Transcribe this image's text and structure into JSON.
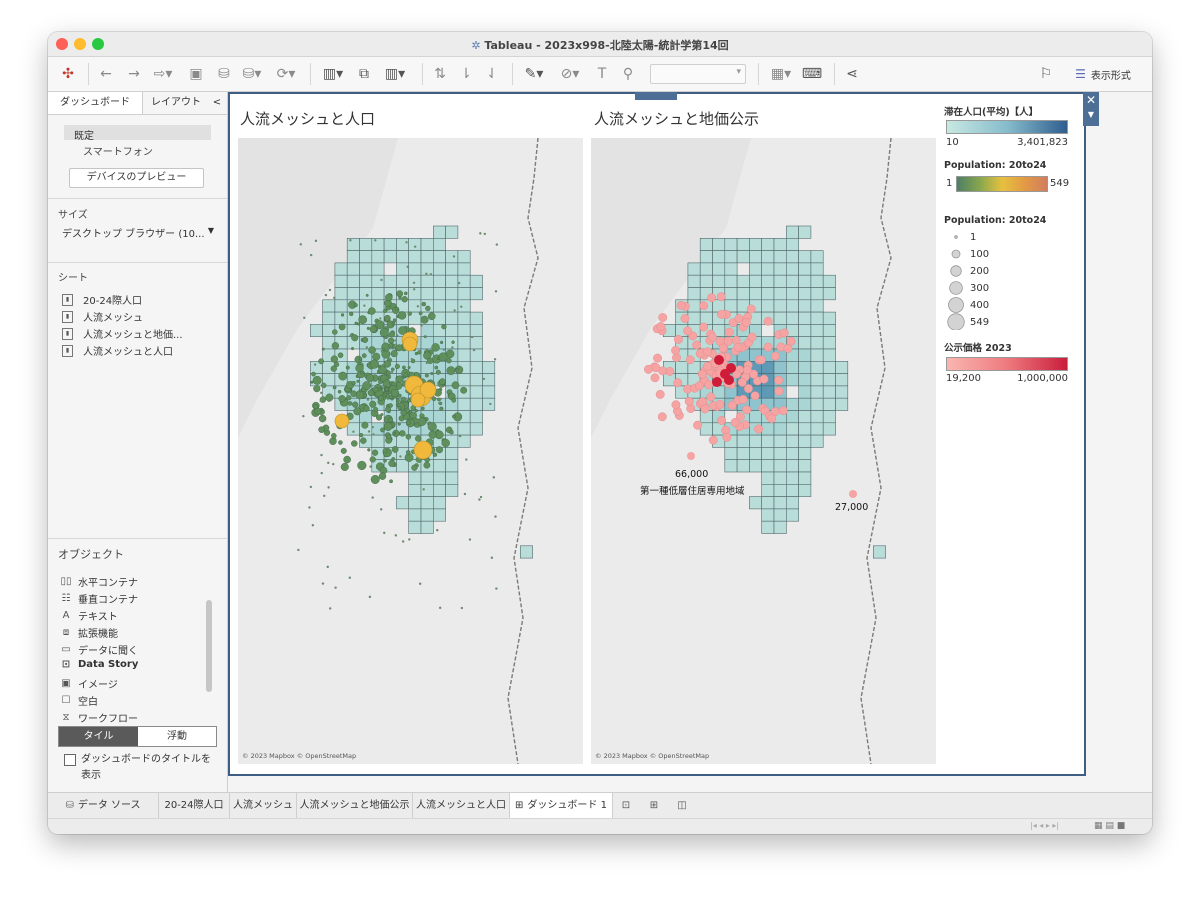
{
  "window": {
    "title": "Tableau - 2023x998-北陸太陽-統計学第14回"
  },
  "colors": {
    "accent": "#3e5e83",
    "mesh_fill": "#b9ded9",
    "mesh_stroke": "#52676a",
    "point_green": "#5f8f5a",
    "point_pink": "#f5a3a3",
    "point_red": "#cf1c38",
    "point_yellow": "#f1b93c"
  },
  "toolbar": {
    "icons": [
      "tableau-logo-icon",
      "back-icon",
      "forward-icon",
      "redo-icon",
      "save-icon",
      "new-datasource-icon",
      "pause-update-icon",
      "refresh-icon",
      "new-worksheet-icon",
      "duplicate-icon",
      "clear-icon",
      "swap-icon",
      "sort-asc-icon",
      "sort-desc-icon",
      "highlight-icon",
      "group-icon",
      "label-icon",
      "pin-icon",
      "fit-select",
      "showme-icon",
      "presentation-icon",
      "share-icon",
      "tooltip-icon"
    ],
    "show_me": "表示形式"
  },
  "sidebar": {
    "tabs": [
      "ダッシュボード",
      "レイアウト"
    ],
    "collapse": "<",
    "device": {
      "default": "既定",
      "phone": "スマートフォン",
      "preview": "デバイスのプレビュー"
    },
    "size": {
      "title": "サイズ",
      "value": "デスクトップ ブラウザー (10..."
    },
    "sheets": {
      "title": "シート",
      "items": [
        "20-24際人口",
        "人流メッシュ",
        "人流メッシュと地価...",
        "人流メッシュと人口"
      ]
    },
    "objects": {
      "title": "オブジェクト",
      "items": [
        "水平コンテナ",
        "垂直コンテナ",
        "テキスト",
        "拡張機能",
        "データに聞く",
        "Data Story",
        "イメージ",
        "空白",
        "ワークフロー"
      ]
    },
    "layout_mode": {
      "tile": "タイル",
      "float": "浮動"
    },
    "show_title": "ダッシュボードのタイトルを表示"
  },
  "dashboard": {
    "left_title": "人流メッシュと人口",
    "right_title": "人流メッシュと地価公示",
    "credit": "© 2023 Mapbox © OpenStreetMap",
    "annotations": {
      "a1_value": "66,000",
      "a1_label": "第一種低層住居専用地域",
      "a2_value": "27,000"
    }
  },
  "legends": {
    "stay": {
      "title": "滞在人口(平均)【人】",
      "min": "10",
      "max": "3,401,823"
    },
    "pop_color": {
      "title": "Population: 20to24",
      "min": "1",
      "max": "549"
    },
    "pop_size": {
      "title": "Population: 20to24",
      "sizes": [
        "1",
        "100",
        "200",
        "300",
        "400",
        "549"
      ]
    },
    "price": {
      "title": "公示価格 2023",
      "min": "19,200",
      "max": "1,000,000"
    }
  },
  "bottom_tabs": [
    "データ ソース",
    "20-24際人口",
    "人流メッシュ",
    "人流メッシュと地価公示",
    "人流メッシュと人口",
    "ダッシュボード 1"
  ]
}
